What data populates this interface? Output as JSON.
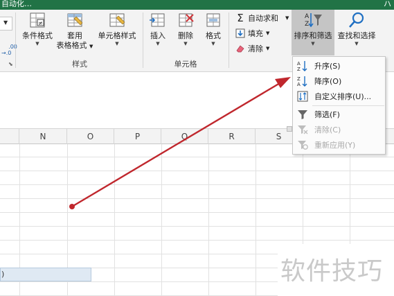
{
  "titlebar": {
    "title": "自动化…",
    "corner": "ハ"
  },
  "ribbon": {
    "number_frag": ".00\n→.0",
    "styles_group": {
      "label": "样式",
      "conditional_format": "条件格式",
      "table_format_1": "套用",
      "table_format_2": "表格格式",
      "cell_styles": "单元格样式"
    },
    "cells_group": {
      "label": "单元格",
      "insert": "插入",
      "delete": "删除",
      "format": "格式"
    },
    "edit_group": {
      "autosum": "自动求和",
      "fill": "填充",
      "clear": "清除",
      "sort_filter": "排序和筛选",
      "find_select": "查找和选择"
    }
  },
  "sort_menu": {
    "items": [
      {
        "label": "升序(S)",
        "disabled": false
      },
      {
        "label": "降序(O)",
        "disabled": false
      },
      {
        "label": "自定义排序(U)...",
        "disabled": false
      },
      {
        "label": "筛选(F)",
        "disabled": false
      },
      {
        "label": "清除(C)",
        "disabled": true
      },
      {
        "label": "重新应用(Y)",
        "disabled": true
      }
    ]
  },
  "grid": {
    "columns": [
      "N",
      "O",
      "P",
      "Q",
      "R",
      "S"
    ],
    "selected_cell_text": ")"
  },
  "annotation": {
    "arrow_color": "#c0272d"
  },
  "watermark": {
    "text": "软件技巧"
  },
  "colors": {
    "title_bar": "#217346",
    "ribbon_bg": "#f3f3f3",
    "pressed": "#c5c5c5"
  }
}
